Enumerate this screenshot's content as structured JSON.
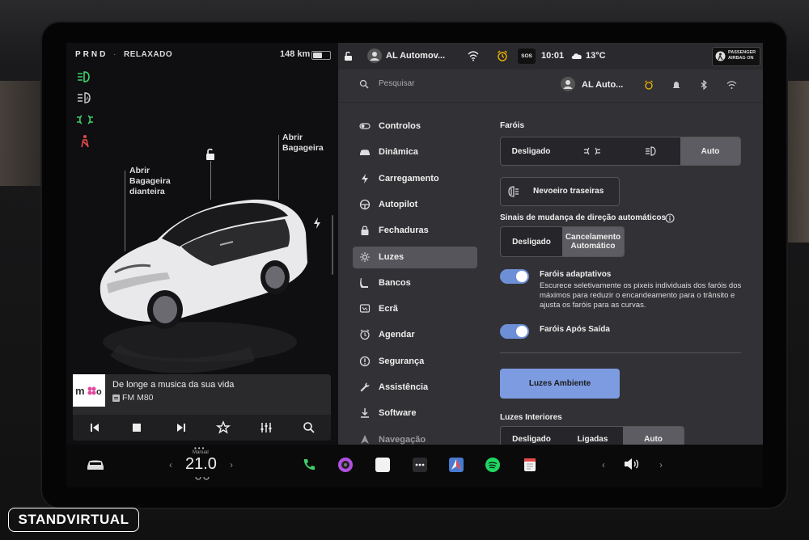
{
  "status": {
    "gear": "PRND",
    "drive_mode": "RELAXADO",
    "range": "148 km",
    "battery_level": 0.55
  },
  "car_labels": {
    "frunk": "Abrir\nBagageira\ndianteira",
    "trunk": "Abrir\nBagageira"
  },
  "media": {
    "title": "De longe a musica da sua vida",
    "source": "FM M80"
  },
  "topbar": {
    "profile": "AL Automov...",
    "time": "10:01",
    "temperature": "13°C",
    "sos": "SOS",
    "airbag": "PASSENGER\nAIRBAG ON"
  },
  "search": {
    "placeholder": "Pesquisar",
    "profile": "AL Auto..."
  },
  "nav": [
    {
      "label": "Controlos",
      "icon": "toggle-icon"
    },
    {
      "label": "Dinâmica",
      "icon": "car-icon"
    },
    {
      "label": "Carregamento",
      "icon": "lightning-icon"
    },
    {
      "label": "Autopilot",
      "icon": "steering-wheel-icon"
    },
    {
      "label": "Fechaduras",
      "icon": "lock-icon"
    },
    {
      "label": "Luzes",
      "icon": "sun-icon",
      "active": true
    },
    {
      "label": "Bancos",
      "icon": "seat-icon"
    },
    {
      "label": "Ecrã",
      "icon": "screen-icon"
    },
    {
      "label": "Agendar",
      "icon": "clock-icon"
    },
    {
      "label": "Segurança",
      "icon": "alert-icon"
    },
    {
      "label": "Assistência",
      "icon": "wrench-icon"
    },
    {
      "label": "Software",
      "icon": "download-icon"
    },
    {
      "label": "Navegação",
      "icon": "navigation-icon"
    }
  ],
  "lights": {
    "farois_label": "Faróis",
    "farois_options": [
      "Desligado",
      "",
      "",
      "Auto"
    ],
    "nevoeiro": "Nevoeiro traseiras",
    "signals_label": "Sinais de mudança de direção automáticos",
    "signals_options": [
      "Desligado",
      "Cancelamento\nAutomático"
    ],
    "adaptive_title": "Faróis adaptativos",
    "adaptive_desc": "Escurece seletivamente os pixeis individuais dos faróis dos máximos para reduzir o encandeamento para o trânsito e ajusta os faróis para as curvas.",
    "after_exit": "Faróis Após Saída",
    "ambient_button": "Luzes Ambiente",
    "interior_label": "Luzes Interiores",
    "interior_options": [
      "Desligado",
      "Ligadas",
      "Auto"
    ]
  },
  "dock": {
    "temp": "21.0",
    "temp_label": "Manual"
  },
  "watermark": "STANDVIRTUAL",
  "colors": {
    "accent": "#7d9be0",
    "toggle": "#6d8fd6",
    "light_green": "#3fd06a",
    "warning_red": "#e24a4a"
  }
}
